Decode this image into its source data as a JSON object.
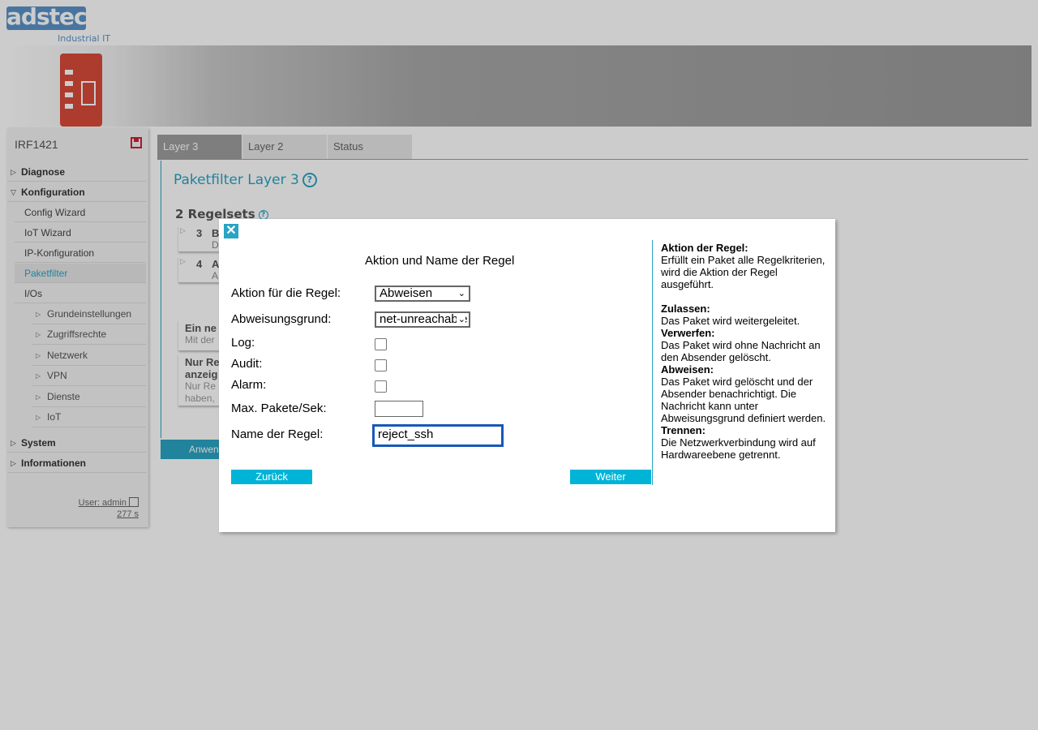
{
  "brand": {
    "logo_text": "adstec",
    "logo_subtitle": "Industrial IT"
  },
  "sidebar": {
    "device_name": "IRF1421",
    "items": {
      "diagnose": "Diagnose",
      "konfiguration": "Konfiguration",
      "system": "System",
      "informationen": "Informationen"
    },
    "konfiguration_children": [
      "Config Wizard",
      "IoT Wizard",
      "IP-Konfiguration",
      "Paketfilter",
      "I/Os"
    ],
    "ios_children": [
      "Grundeinstellungen",
      "Zugriffsrechte",
      "Netzwerk",
      "VPN",
      "Dienste",
      "IoT"
    ],
    "user": "User: admin",
    "timer": "277 s"
  },
  "tabs": [
    "Layer 3",
    "Layer 2",
    "Status"
  ],
  "main": {
    "title": "Paketfilter Layer 3",
    "rulesets_title": "2 Regelsets",
    "rulesets": [
      {
        "num": "3",
        "name": "B",
        "desc": "D"
      },
      {
        "num": "4",
        "name": "A",
        "desc": "A"
      }
    ],
    "info1": {
      "title": "Ein ne",
      "desc": "Mit der"
    },
    "info2": {
      "title1": "Nur Re",
      "title2": "anzeig",
      "desc1": "Nur Re",
      "desc2": "haben,"
    },
    "apply_label": "Anwen"
  },
  "dialog": {
    "title": "Aktion und Name der Regel",
    "action_label": "Aktion für die Regel:",
    "action_value": "Abweisen",
    "reason_label": "Abweisungsgrund:",
    "reason_value": "net-unreachable",
    "log_label": "Log:",
    "audit_label": "Audit:",
    "alarm_label": "Alarm:",
    "maxpk_label": "Max. Pakete/Sek:",
    "maxpk_value": "",
    "name_label": "Name der Regel:",
    "name_value": "reject_ssh",
    "back_label": "Zurück",
    "next_label": "Weiter",
    "help": {
      "h1": "Aktion der Regel:",
      "p1": "Erfüllt ein Paket alle Regelkriterien, wird die Aktion der Regel ausgeführt.",
      "h2": "Zulassen:",
      "p2": "Das Paket wird weitergeleitet.",
      "h3": "Verwerfen:",
      "p3": "Das Paket wird ohne Nachricht an den Absender gelöscht.",
      "h4": "Abweisen:",
      "p4": "Das Paket wird gelöscht und der Absender benachrichtigt. Die Nachricht kann unter Abweisungsgrund definiert werden.",
      "h5": "Trennen:",
      "p5": "Die Netzwerkverbindung wird auf Hardwareebene getrennt."
    }
  },
  "colors": {
    "accent": "#2aa4c4",
    "button": "#00b4d8",
    "brand": "#5a93c8",
    "device": "#d94a3a"
  }
}
